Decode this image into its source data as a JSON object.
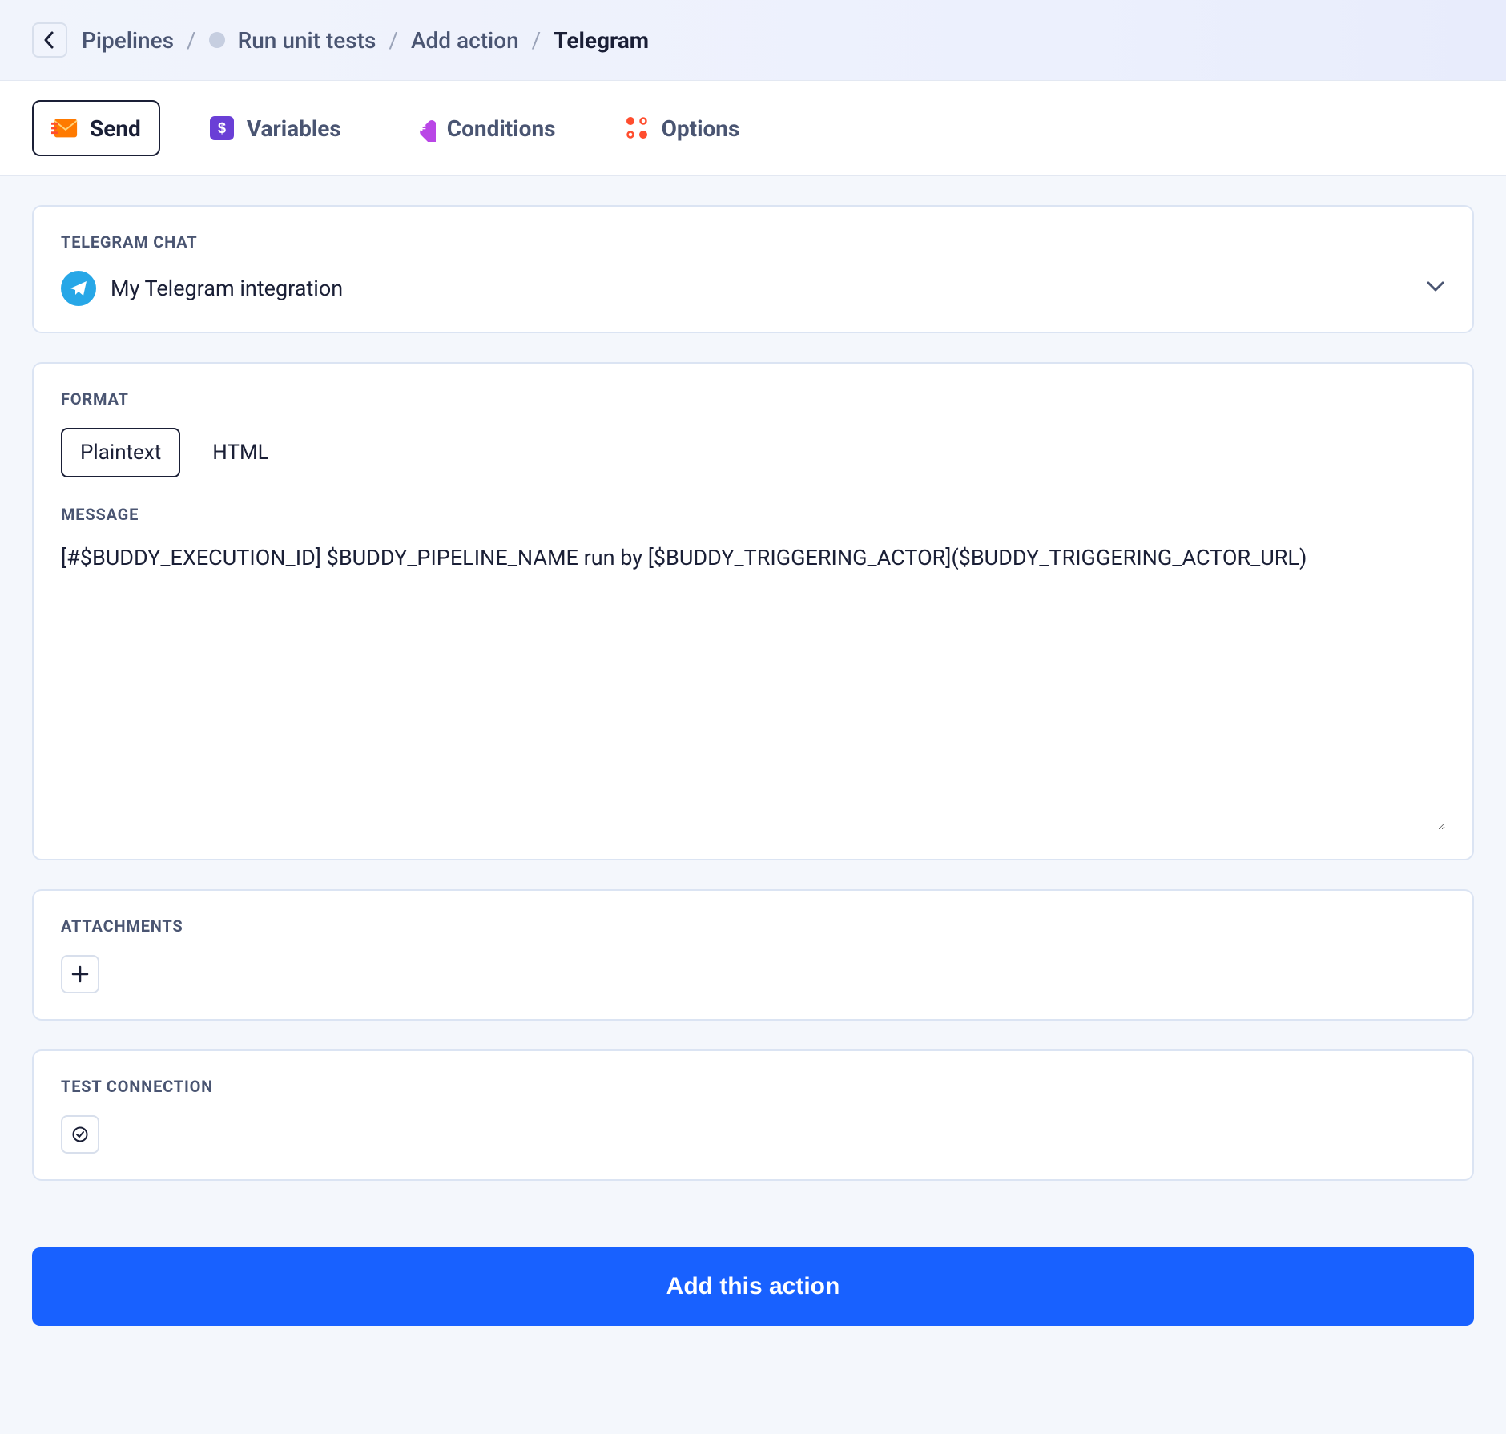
{
  "breadcrumb": {
    "pipelines": "Pipelines",
    "run_tests": "Run unit tests",
    "add_action": "Add action",
    "current": "Telegram"
  },
  "tabs": {
    "send": "Send",
    "variables": "Variables",
    "conditions": "Conditions",
    "options": "Options"
  },
  "sections": {
    "telegram_chat_label": "TELEGRAM CHAT",
    "chat_value": "My Telegram integration",
    "format_label": "FORMAT",
    "format_plaintext": "Plaintext",
    "format_html": "HTML",
    "message_label": "MESSAGE",
    "message_value": "[#$BUDDY_EXECUTION_ID] $BUDDY_PIPELINE_NAME run by [$BUDDY_TRIGGERING_ACTOR]($BUDDY_TRIGGERING_ACTOR_URL)",
    "attachments_label": "ATTACHMENTS",
    "test_connection_label": "TEST CONNECTION"
  },
  "footer": {
    "add_button": "Add this action"
  },
  "colors": {
    "primary": "#1861ff",
    "telegram": "#27a7e7"
  }
}
